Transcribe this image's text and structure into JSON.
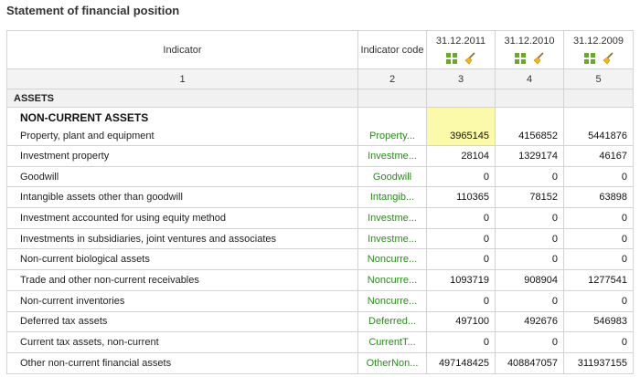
{
  "page": {
    "title": "Statement of financial position"
  },
  "columns": {
    "indicator": "Indicator",
    "indicator_code": "Indicator code",
    "years": [
      "31.12.2011",
      "31.12.2010",
      "31.12.2009"
    ],
    "numbers": [
      "1",
      "2",
      "3",
      "4",
      "5"
    ]
  },
  "icons": {
    "grid": "grid-icon",
    "broom": "broom-icon"
  },
  "colors": {
    "code_link": "#2a8a1c",
    "selected_cell": "#fafaaa",
    "grid_icon": "#6aaa2a"
  },
  "sections": {
    "assets": "ASSETS",
    "noncurrent_assets": "NON-CURRENT ASSETS"
  },
  "rows": [
    {
      "label": "Property, plant and equipment",
      "code": "Property...",
      "values": [
        "3965145",
        "4156852",
        "5441876"
      ]
    },
    {
      "label": "Investment property",
      "code": "Investme...",
      "values": [
        "28104",
        "1329174",
        "46167"
      ]
    },
    {
      "label": "Goodwill",
      "code": "Goodwill",
      "values": [
        "0",
        "0",
        "0"
      ]
    },
    {
      "label": "Intangible assets other than goodwill",
      "code": "Intangib...",
      "values": [
        "110365",
        "78152",
        "63898"
      ]
    },
    {
      "label": "Investment accounted for using equity method",
      "code": "Investme...",
      "values": [
        "0",
        "0",
        "0"
      ]
    },
    {
      "label": "Investments in subsidiaries, joint ventures and associates",
      "code": "Investme...",
      "values": [
        "0",
        "0",
        "0"
      ]
    },
    {
      "label": "Non-current biological assets",
      "code": "Noncurre...",
      "values": [
        "0",
        "0",
        "0"
      ]
    },
    {
      "label": "Trade and other non-current receivables",
      "code": "Noncurre...",
      "values": [
        "1093719",
        "908904",
        "1277541"
      ]
    },
    {
      "label": "Non-current inventories",
      "code": "Noncurre...",
      "values": [
        "0",
        "0",
        "0"
      ]
    },
    {
      "label": "Deferred tax assets",
      "code": "Deferred...",
      "values": [
        "497100",
        "492676",
        "546983"
      ]
    },
    {
      "label": "Current tax assets, non-current",
      "code": "CurrentT...",
      "values": [
        "0",
        "0",
        "0"
      ]
    },
    {
      "label": "Other non-current financial assets",
      "code": "OtherNon...",
      "values": [
        "497148425",
        "408847057",
        "311937155"
      ]
    }
  ]
}
